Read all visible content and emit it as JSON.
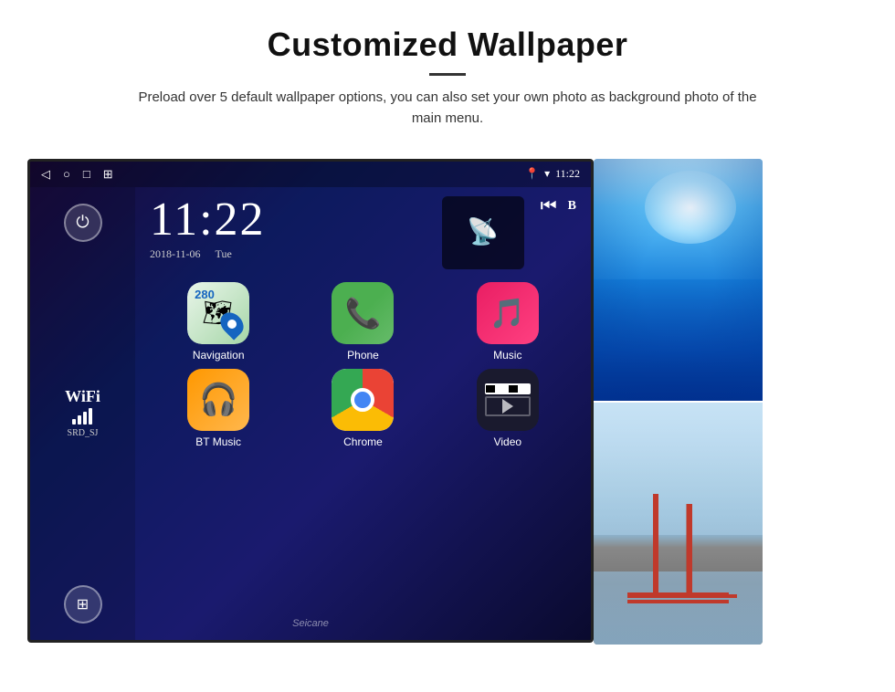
{
  "header": {
    "title": "Customized Wallpaper",
    "description": "Preload over 5 default wallpaper options, you can also set your own photo as background photo of the main menu."
  },
  "screen": {
    "status_bar": {
      "time": "11:22",
      "nav_icons": [
        "◁",
        "○",
        "□",
        "⊞"
      ],
      "signal_icon": "📍",
      "wifi_icon": "▾"
    },
    "clock": {
      "time": "11:22",
      "date": "2018-11-06",
      "day": "Tue"
    },
    "wifi_widget": {
      "label": "WiFi",
      "ssid": "SRD_SJ"
    },
    "apps": [
      {
        "name": "Navigation",
        "type": "nav"
      },
      {
        "name": "Phone",
        "type": "phone"
      },
      {
        "name": "Music",
        "type": "music"
      },
      {
        "name": "BT Music",
        "type": "btmusic"
      },
      {
        "name": "Chrome",
        "type": "chrome"
      },
      {
        "name": "Video",
        "type": "video"
      }
    ],
    "nav_label": "280 Navigation",
    "watermark": "Seicane"
  },
  "wallpapers": {
    "top_alt": "Ice cave wallpaper",
    "bottom_alt": "Golden Gate Bridge wallpaper"
  }
}
